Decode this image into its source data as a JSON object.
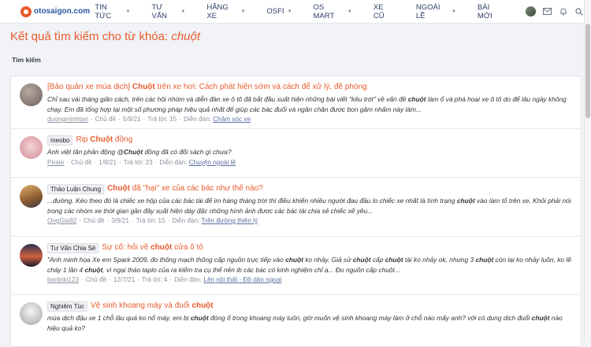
{
  "site": {
    "logo_left": "otosaigon",
    "logo_right": ".com"
  },
  "nav": [
    {
      "label": "TIN TỨC",
      "caret": true
    },
    {
      "label": "TƯ VẤN",
      "caret": true
    },
    {
      "label": "HÃNG XE",
      "caret": true
    },
    {
      "label": "OSFI",
      "caret": true
    },
    {
      "label": "OS MART",
      "caret": true
    },
    {
      "label": "XE CŨ",
      "caret": false
    },
    {
      "label": "NGOÀI LỀ",
      "caret": true
    },
    {
      "label": "BÀI MỚI",
      "caret": false
    }
  ],
  "page": {
    "title_prefix": "Kết quả tìm kiếm cho từ khóa: ",
    "keyword": "chuột",
    "section": "Tìm kiếm"
  },
  "results": [
    {
      "tag": "",
      "prefix": "[Bảo quản xe mùa dịch] ",
      "title_hl": "Chuột",
      "title_rest": " trên xe hơi: Cách phát hiện sớm và cách để xử lý, đề phòng",
      "snippet_1": "Chỉ sau vài tháng giãn cách, trên các hội nhóm và diễn đàn xe ô tô đã bắt đầu xuất hiện những bài viết \"kêu trời\" về vấn đề ",
      "snippet_hl": "chuột",
      "snippet_2": " làm ổ và phá hoại xe ô tô do để lâu ngày không chạy. Em đã tổng hợp lại một số phương pháp hiệu quả nhất để giúp các bác đuổi và ngăn chặn được bọn gặm nhấm này làm...",
      "author": "duongminhtan",
      "type": "Chủ đề",
      "date": "5/9/21",
      "replies": "Trả lời: 15",
      "forum_label": "Diễn đàn: ",
      "forum": "Chăm sóc xe"
    },
    {
      "tag": "meobo",
      "prefix": "",
      "title_hl": "Chuột",
      "title_rest_prefix": "Rip ",
      "title_rest": " đồng",
      "snippet_1": "Anh việt tân phản động @",
      "snippet_hl": "Chuột",
      "snippet_2": " đồng đã có đối sách gì chưa?",
      "author": "Pirate",
      "type": "Chủ đề",
      "date": "1/8/21",
      "replies": "Trả lời: 23",
      "forum_label": "Diễn đàn: ",
      "forum": "Chuyện ngoài lề"
    },
    {
      "tag": "Thảo Luận Chung",
      "prefix": "",
      "title_hl": "Chuột",
      "title_rest": " đã \"hại\" xe của các bác như thế nào?",
      "snippet_1": "...đường. Kéo theo đó là chiếc xe hộp của các bác tài để im hàng tháng trời thì điều khiến nhiều người đau đầu lo chiếc xe nhất là tình trạng ",
      "snippet_hl": "chuột",
      "snippet_2": " vào làm tổ trên xe. Khỏi phải nói trong các nhóm xe thời gian gần đây xuất hiện dày đặc những hình ảnh được các bác tài chia sẻ chiếc xế yêu...",
      "author": "OngGia92",
      "type": "Chủ đề",
      "date": "3/9/21",
      "replies": "Trả lời: 15",
      "forum_label": "Diễn đàn: ",
      "forum": "Trên đường thiên lý"
    },
    {
      "tag": "Tư Vấn Chia Sẻ",
      "prefix": "",
      "title_pre": "Sự cố: hỏi về ",
      "title_hl": "chuột",
      "title_rest": " cửa ô tô",
      "snippet_html_parts": [
        "\"Anh minh họa Xe em Spark 2009, đo thông mạch thông cấp nguồn trực tiếp vào ",
        "chuột",
        " ko nhảy. Giả sử ",
        "chuột",
        " cấp ",
        "chuột",
        " tài ko nhảy ok, nhưng 3 ",
        "chuột",
        " còn lại ko nhảy luôn, ko lẽ cháy 1 lần 4 ",
        "chuột",
        ", vì ngại tháo taplo của ra kiểm tra cụ thể nên ib các bác có kinh nghiệm chỉ ạ... Đo nguồn cấp chuột..."
      ],
      "author": "bantriki123",
      "type": "Chủ đề",
      "date": "12/7/21",
      "replies": "Trả lời: 4",
      "forum_label": "Diễn đàn: ",
      "forum": "Lên nội thất - Đồ dân ngoại"
    },
    {
      "tag": "Nghiêm Túc",
      "prefix": "",
      "title_pre": "Vệ sinh khoang máy và đuổi ",
      "title_hl": "chuột",
      "title_rest": "",
      "snippet_html_parts": [
        "mùa dịch đậu xe 1 chỗ lâu quá ko nổ máy, em bị ",
        "chuột",
        " đóng ổ trong khoang máy luôn, giờ muốn vệ sinh khoang máy làm ở chỗ nào mấy anh? với có dung dịch đuổi ",
        "chuột",
        " nào hiệu quả ko?"
      ],
      "author": "",
      "type": "",
      "date": "",
      "replies": "",
      "forum_label": "",
      "forum": ""
    }
  ],
  "colors": {
    "accent": "#e85a2c",
    "nav": "#2c3e66"
  }
}
